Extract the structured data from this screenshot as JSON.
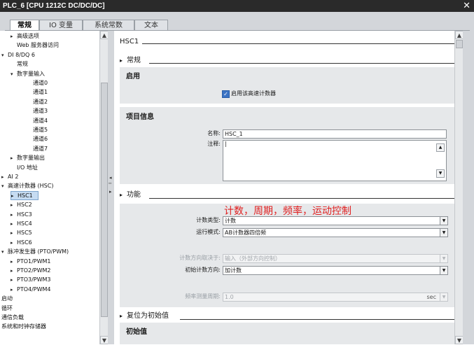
{
  "window": {
    "title": "PLC_6 [CPU 1212C DC/DC/DC]",
    "close_glyph": "✕"
  },
  "tabs": [
    "常规",
    "IO 变量",
    "系统常数",
    "文本"
  ],
  "tree": [
    {
      "label": "高级选项",
      "arrow": "▸",
      "indent": 1
    },
    {
      "label": "Web 服务器访问",
      "arrow": "",
      "indent": 1
    },
    {
      "label": "DI 8/DQ 6",
      "arrow": "▾",
      "indent": 0
    },
    {
      "label": "常规",
      "arrow": "",
      "indent": 1
    },
    {
      "label": "数字量输入",
      "arrow": "▾",
      "indent": 1
    },
    {
      "label": "通道0",
      "arrow": "",
      "indent": 3
    },
    {
      "label": "通道1",
      "arrow": "",
      "indent": 3
    },
    {
      "label": "通道2",
      "arrow": "",
      "indent": 3
    },
    {
      "label": "通道3",
      "arrow": "",
      "indent": 3
    },
    {
      "label": "通道4",
      "arrow": "",
      "indent": 3
    },
    {
      "label": "通道5",
      "arrow": "",
      "indent": 3
    },
    {
      "label": "通道6",
      "arrow": "",
      "indent": 3
    },
    {
      "label": "通道7",
      "arrow": "",
      "indent": 3
    },
    {
      "label": "数字量输出",
      "arrow": "▸",
      "indent": 1
    },
    {
      "label": "I/O 地址",
      "arrow": "",
      "indent": 1
    },
    {
      "label": "AI 2",
      "arrow": "▸",
      "indent": 0
    },
    {
      "label": "高速计数器 (HSC)",
      "arrow": "▾",
      "indent": 0
    },
    {
      "label": "HSC1",
      "arrow": "▸",
      "indent": 1,
      "selected": true
    },
    {
      "label": "HSC2",
      "arrow": "▸",
      "indent": 1
    },
    {
      "label": "HSC3",
      "arrow": "▸",
      "indent": 1
    },
    {
      "label": "HSC4",
      "arrow": "▸",
      "indent": 1
    },
    {
      "label": "HSC5",
      "arrow": "▸",
      "indent": 1
    },
    {
      "label": "HSC6",
      "arrow": "▸",
      "indent": 1
    },
    {
      "label": "脉冲发生器 (PTO/PWM)",
      "arrow": "▾",
      "indent": 0
    },
    {
      "label": "PTO1/PWM1",
      "arrow": "▸",
      "indent": 1
    },
    {
      "label": "PTO2/PWM2",
      "arrow": "▸",
      "indent": 1
    },
    {
      "label": "PTO3/PWM3",
      "arrow": "▸",
      "indent": 1
    },
    {
      "label": "PTO4/PWM4",
      "arrow": "▸",
      "indent": 1
    },
    {
      "label": "启动",
      "arrow": "",
      "indent": 0
    },
    {
      "label": "循环",
      "arrow": "",
      "indent": 0
    },
    {
      "label": "通信负载",
      "arrow": "",
      "indent": 0
    },
    {
      "label": "系统和时钟存储器",
      "arrow": "",
      "indent": 0
    }
  ],
  "content": {
    "heading": "HSC1",
    "section_general": "常规",
    "group_enable": "启用",
    "enable_checkbox_label": "启用该高速计数器",
    "group_project_info": "项目信息",
    "name_label": "名称:",
    "name_value": "HSC_1",
    "comment_label": "注释:",
    "comment_value": "|",
    "section_function": "功能",
    "annotation": "计数，周期，频率，运动控制",
    "count_type_label": "计数类型:",
    "count_type_value": "计数",
    "mode_label": "运行模式:",
    "mode_value": "AB计数器四倍频",
    "dir_source_label": "计数方向取决于:",
    "dir_source_value": "输入（外部方向控制）",
    "init_dir_label": "初始计数方向:",
    "init_dir_value": "加计数",
    "freq_period_label": "频率测量周期:",
    "freq_period_value": "1.0",
    "freq_period_unit": "sec",
    "section_reset": "复位为初始值",
    "group_initial": "初始值"
  },
  "icons": {
    "dropdown": "▼",
    "scroll_up": "▲",
    "scroll_down": "▼",
    "checkmark": "✓",
    "expand": "▸"
  },
  "colors": {
    "annotation": "#e02020",
    "selection": "#c6dcf2",
    "checkbox": "#3b73c4"
  }
}
